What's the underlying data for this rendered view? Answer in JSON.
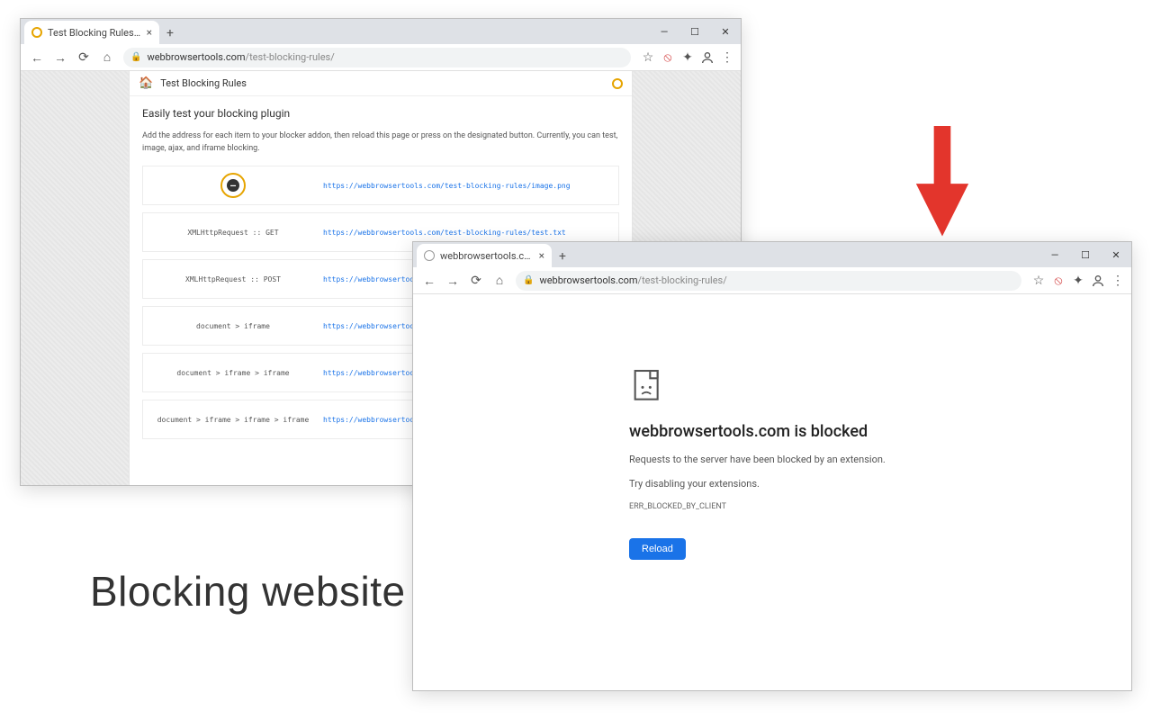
{
  "caption": "Blocking website",
  "window1": {
    "tab_title": "Test Blocking Rules :: WebBrows",
    "url_host": "webbrowsertools.com",
    "url_path": "/test-blocking-rules/",
    "page_title": "Test Blocking Rules",
    "subheading": "Easily test your blocking plugin",
    "description": "Add the address for each item to your blocker addon, then reload this page or press on the designated button. Currently, you can test, image, ajax, and iframe blocking.",
    "rows": [
      {
        "label": "",
        "icon": true,
        "url": "https://webbrowsertools.com/test-blocking-rules/image.png"
      },
      {
        "label": "XMLHttpRequest :: GET",
        "url": "https://webbrowsertools.com/test-blocking-rules/test.txt"
      },
      {
        "label": "XMLHttpRequest :: POST",
        "url": "https://webbrowsertools.com"
      },
      {
        "label": "document > iframe",
        "url": "https://webbrowsertools.com"
      },
      {
        "label": "document > iframe > iframe",
        "url": "https://webbrowsertools.com"
      },
      {
        "label": "document > iframe > iframe > iframe",
        "url": "https://webbrowsertools.com"
      }
    ]
  },
  "window2": {
    "tab_title": "webbrowsertools.com",
    "url_host": "webbrowsertools.com",
    "url_path": "/test-blocking-rules/",
    "blocked_title": "webbrowsertools.com is blocked",
    "blocked_line1": "Requests to the server have been blocked by an extension.",
    "blocked_line2": "Try disabling your extensions.",
    "blocked_err": "ERR_BLOCKED_BY_CLIENT",
    "reload_label": "Reload"
  },
  "glyphs": {
    "minimize": "—",
    "maximize": "☐",
    "close": "✕",
    "back": "←",
    "forward": "→",
    "reload": "⟳",
    "home": "⌂",
    "lock": "🔒",
    "star": "☆",
    "puzzle": "✦",
    "user": "◯",
    "menu": "⋮",
    "plus": "+",
    "tabclose": "×",
    "minus": "—"
  }
}
